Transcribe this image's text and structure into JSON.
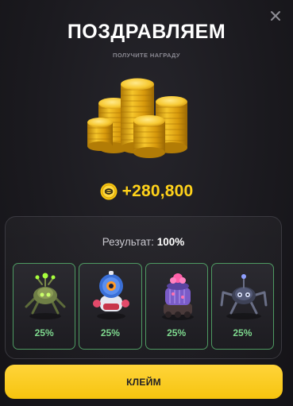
{
  "header": {
    "title": "ПОЗДРАВЛЯЕМ",
    "subtitle": "ПОЛУЧИТЕ НАГРАДУ"
  },
  "icons": {
    "close": "close-icon",
    "coins": "coin-stack-icon",
    "currency": "coin-icon"
  },
  "reward": {
    "amount": "+280,800"
  },
  "result": {
    "label": "Результат:",
    "value": "100%",
    "items": [
      {
        "name": "green-spider-bot",
        "chance": "25%"
      },
      {
        "name": "blue-orange-robot",
        "chance": "25%"
      },
      {
        "name": "purple-cactus-bot",
        "chance": "25%"
      },
      {
        "name": "dark-spider-bot",
        "chance": "25%"
      }
    ]
  },
  "footer": {
    "claim_label": "КЛЕЙМ"
  },
  "colors": {
    "accent": "#f6c40e",
    "reward_text": "#ffd21a",
    "chance_text": "#7ed88e",
    "item_border": "#4e9a62",
    "background": "#1b1a1f"
  }
}
